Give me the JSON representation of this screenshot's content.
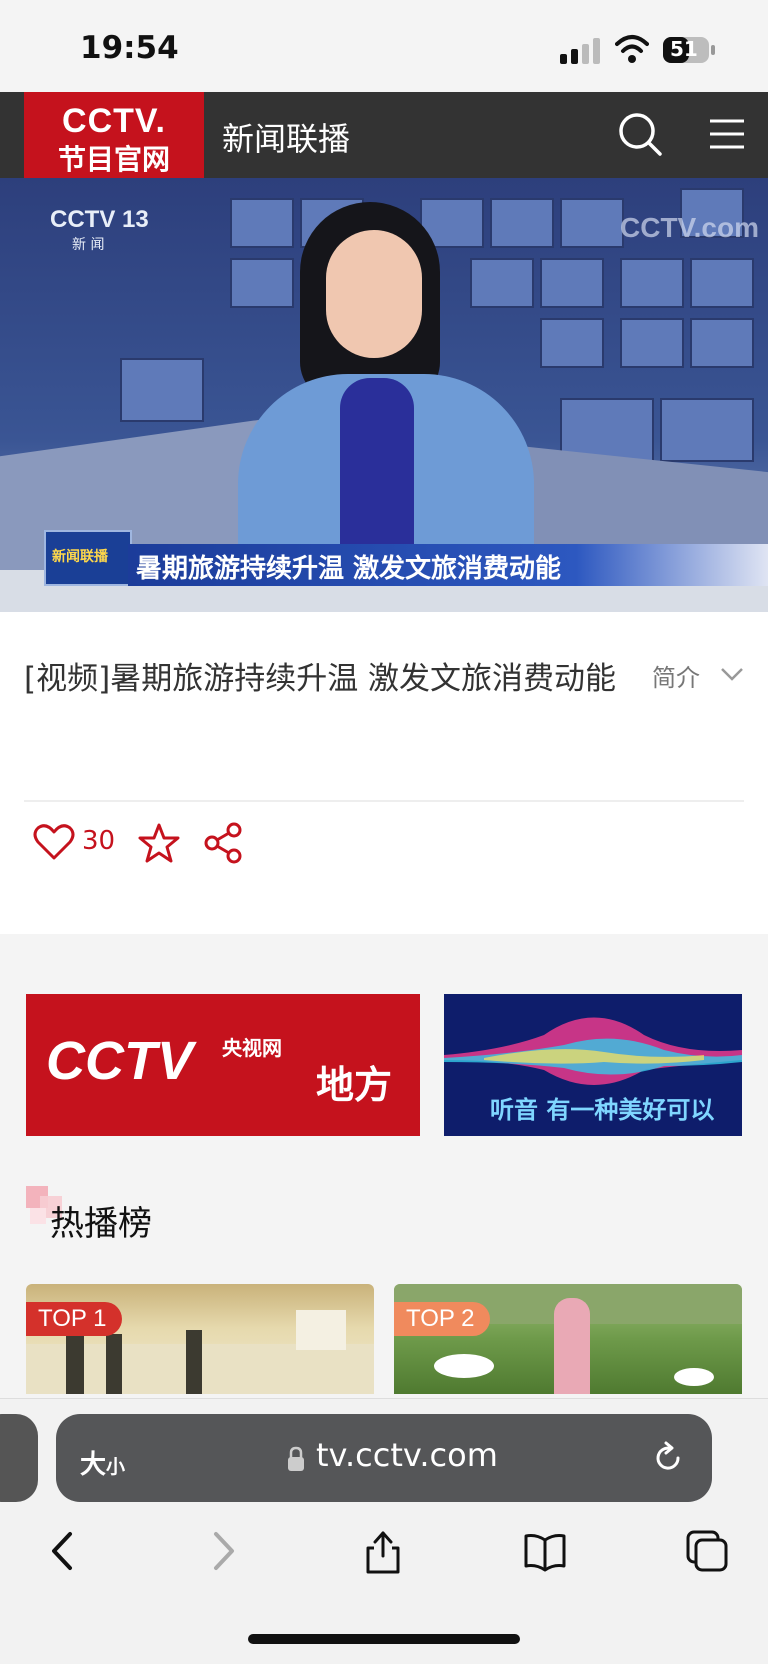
{
  "status_bar": {
    "time": "19:54",
    "battery": "51"
  },
  "header": {
    "logo_line1": "CCTV.",
    "logo_line2": "节目官网",
    "channel_title": "新闻联播"
  },
  "video": {
    "channel_logo": "CCTV 13",
    "channel_sub": "新 闻",
    "watermark": "CCTV.com",
    "caption_logo": "新闻联播",
    "caption": "暑期旅游持续升温 激发文旅消费动能"
  },
  "info": {
    "title": "[视频]暑期旅游持续升温 激发文旅消费动能",
    "intro_label": "简介",
    "like_count": "30"
  },
  "banners": {
    "local_logo": "CCTV",
    "local_site": "央视网",
    "local_label": "地方",
    "audio_text": "听音 有一种美好可以"
  },
  "hot_list": {
    "title": "热播榜",
    "items": [
      {
        "badge": "TOP 1"
      },
      {
        "badge": "TOP 2"
      }
    ]
  },
  "browser": {
    "text_size_big": "大",
    "text_size_small": "小",
    "url": "tv.cctv.com"
  },
  "colors": {
    "brand_red": "#c5121d",
    "header_dark": "#333333"
  }
}
